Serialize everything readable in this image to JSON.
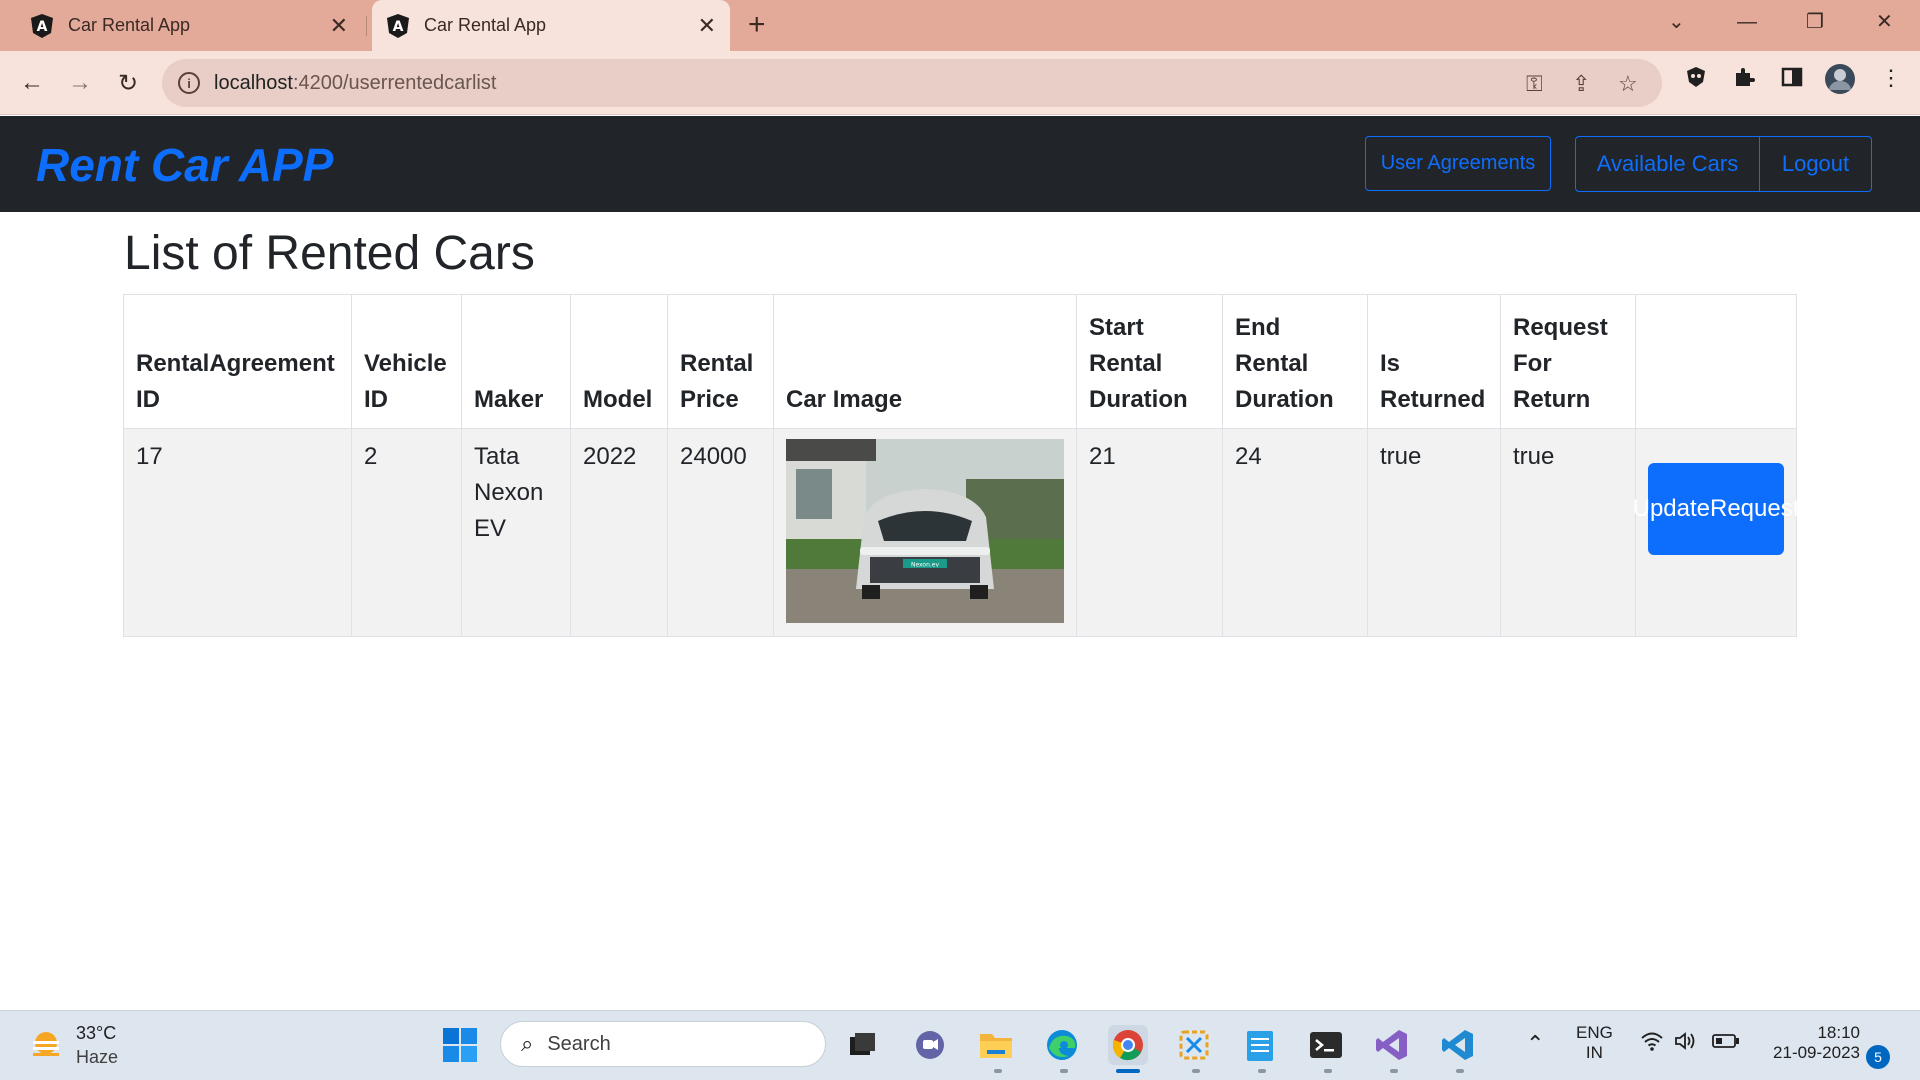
{
  "browser": {
    "tabs": [
      {
        "title": "Car Rental App",
        "active": false
      },
      {
        "title": "Car Rental App",
        "active": true
      }
    ],
    "url_host": "localhost",
    "url_rest": ":4200/userrentedcarlist"
  },
  "app": {
    "brand": "Rent Car APP",
    "nav": {
      "user_agreements": "User Agreements",
      "available_cars": "Available Cars",
      "logout": "Logout"
    },
    "page_title": "List of Rented Cars",
    "table": {
      "headers": {
        "rental_id": [
          "RentalAgreement",
          "ID"
        ],
        "vehicle_id": [
          "Vehicle",
          "ID"
        ],
        "maker": "Maker",
        "model": "Model",
        "price": [
          "Rental",
          "Price"
        ],
        "image": "Car Image",
        "start": [
          "Start",
          "Rental",
          "Duration"
        ],
        "end": [
          "End",
          "Rental",
          "Duration"
        ],
        "returned": [
          "Is",
          "Returned"
        ],
        "request": [
          "Request",
          "For",
          "Return"
        ]
      },
      "rows": [
        {
          "rental_id": "17",
          "vehicle_id": "2",
          "maker": [
            "Tata",
            "Nexon",
            "EV"
          ],
          "model": "2022",
          "price": "24000",
          "image_badge": "Nexon.ev",
          "start": "21",
          "end": "24",
          "returned": "true",
          "request": "true",
          "action": [
            "Update",
            "Request"
          ]
        }
      ]
    }
  },
  "taskbar": {
    "weather": {
      "temp": "33°C",
      "condition": "Haze"
    },
    "search_placeholder": "Search",
    "lang": [
      "ENG",
      "IN"
    ],
    "time": "18:10",
    "date": "21-09-2023",
    "notifications": "5"
  },
  "colors": {
    "accent": "#0d6efd",
    "navbar_bg": "#212529",
    "tabstrip_bg": "#e3a999"
  }
}
